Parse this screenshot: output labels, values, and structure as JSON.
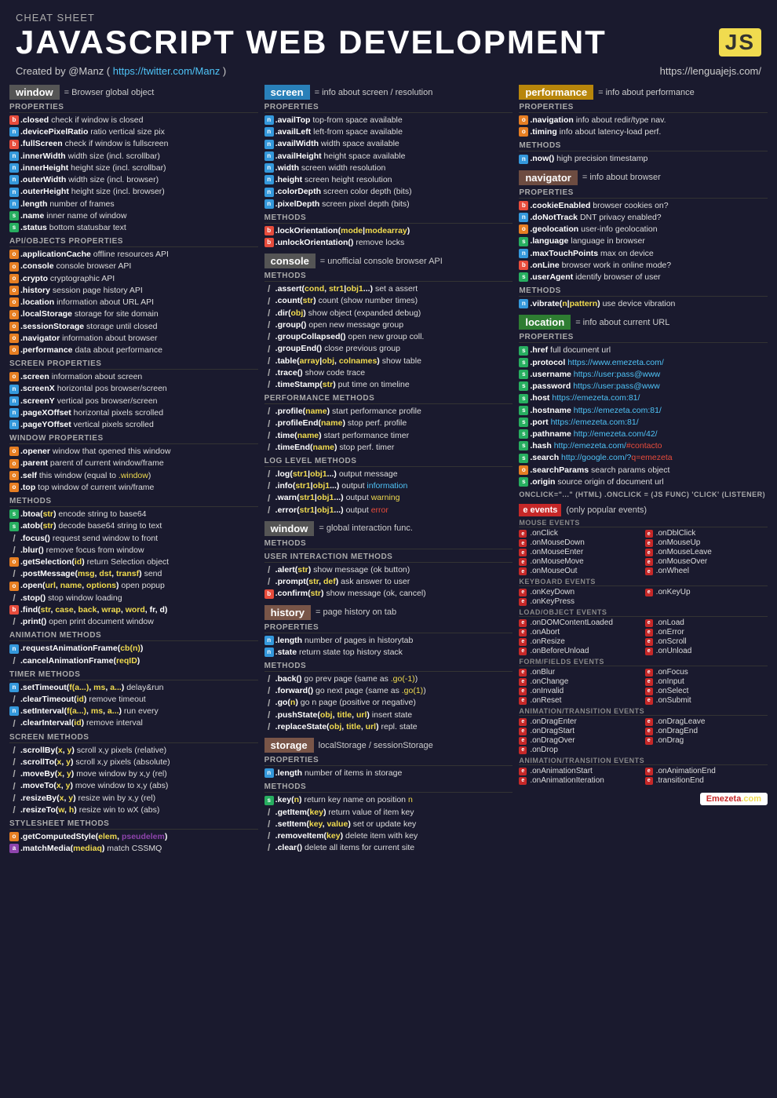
{
  "header": {
    "cheat_label": "CHEAT SHEET",
    "title": "JAVASCRIPT  WEB DEVELOPMENT",
    "js_badge": "JS",
    "credit": "Created by @Manz ( https://twitter.com/Manz )",
    "site": "https://lenguajejs.com/"
  },
  "window": {
    "title": "window",
    "desc": "= Browser global object",
    "props_label": "PROPERTIES",
    "props": [
      {
        "badge": "b",
        "name": ".closed",
        "desc": "check if window is closed"
      },
      {
        "badge": "n",
        "name": ".devicePixelRatio",
        "desc": "ratio vertical size pix"
      },
      {
        "badge": "b",
        "name": ".fullScreen",
        "desc": "check if window is fullscreen"
      },
      {
        "badge": "n",
        "name": ".innerWidth",
        "desc": "width size (incl. scrollbar)"
      },
      {
        "badge": "n",
        "name": ".innerHeight",
        "desc": "height size (incl. scrollbar)"
      },
      {
        "badge": "n",
        "name": ".outerWidth",
        "desc": "width size (incl. browser)"
      },
      {
        "badge": "n",
        "name": ".outerHeight",
        "desc": "height size (incl. browser)"
      },
      {
        "badge": "n",
        "name": ".length",
        "desc": "number of frames"
      },
      {
        "badge": "s",
        "name": ".name",
        "desc": "inner name of window"
      },
      {
        "badge": "s",
        "name": ".status",
        "desc": "bottom statusbar text"
      }
    ],
    "api_label": "API/OBJECTS PROPERTIES",
    "api_props": [
      {
        "badge": "o",
        "name": ".applicationCache",
        "desc": "offline resources API"
      },
      {
        "badge": "o",
        "name": ".console",
        "desc": "console browser API"
      },
      {
        "badge": "o",
        "name": ".crypto",
        "desc": "cryptographic API"
      },
      {
        "badge": "o",
        "name": ".history",
        "desc": "session page history API"
      },
      {
        "badge": "o",
        "name": ".location",
        "desc": "information about URL API"
      },
      {
        "badge": "o",
        "name": ".localStorage",
        "desc": "storage for site domain"
      },
      {
        "badge": "o",
        "name": ".sessionStorage",
        "desc": "storage until closed"
      },
      {
        "badge": "o",
        "name": ".navigator",
        "desc": "information about browser"
      },
      {
        "badge": "o",
        "name": ".performance",
        "desc": "data about performance"
      }
    ],
    "screen_label": "SCREEN PROPERTIES",
    "screen_props": [
      {
        "badge": "o",
        "name": ".screen",
        "desc": "information about screen"
      },
      {
        "badge": "n",
        "name": ".screenX",
        "desc": "horizontal pos browser/screen"
      },
      {
        "badge": "n",
        "name": ".screenY",
        "desc": "vertical pos browser/screen"
      },
      {
        "badge": "n",
        "name": ".pageXOffset",
        "desc": "horizontal pixels scrolled"
      },
      {
        "badge": "n",
        "name": ".pageYOffset",
        "desc": "vertical pixels scrolled"
      }
    ],
    "window_label": "WINDOW PROPERTIES",
    "window_props": [
      {
        "badge": "o",
        "name": ".opener",
        "desc": "window that opened this window"
      },
      {
        "badge": "o",
        "name": ".parent",
        "desc": "parent of current window/frame"
      },
      {
        "badge": "o",
        "name": ".self",
        "desc": "this window (equal to .window)"
      },
      {
        "badge": "o",
        "name": ".top",
        "desc": "top window of current win/frame"
      }
    ],
    "methods_label": "METHODS",
    "methods": [
      {
        "badge": "s",
        "name": ".btoa(str)",
        "desc": "encode string to base64"
      },
      {
        "badge": "s",
        "name": ".atob(str)",
        "desc": "decode base64 string to text"
      },
      {
        "badge": "/",
        "name": ".focus()",
        "desc": "request send window to front"
      },
      {
        "badge": "/",
        "name": ".blur()",
        "desc": "remove focus from window"
      },
      {
        "badge": "o",
        "name": ".getSelection(id)",
        "desc": "return Selection object"
      },
      {
        "badge": "/",
        "name": ".postMessage(msg, dst, transf)",
        "desc": "send"
      },
      {
        "badge": "o",
        "name": ".open(url, name, options)",
        "desc": "open popup"
      },
      {
        "badge": "/",
        "name": ".stop()",
        "desc": "stop window loading"
      },
      {
        "badge": "b",
        "name": ".find(str, case, back, wrap, word, fr, d)"
      },
      {
        "badge": "/",
        "name": ".print()",
        "desc": "open print document window"
      }
    ],
    "anim_label": "ANIMATION METHODS",
    "anim_methods": [
      {
        "badge": "n",
        "name": ".requestAnimationFrame(cb(n))"
      },
      {
        "badge": "/",
        "name": ".cancelAnimationFrame(reqID)"
      }
    ],
    "timer_label": "TIMER METHODS",
    "timer_methods": [
      {
        "badge": "n",
        "name": ".setTimeout(f(a...), ms, a...)",
        "desc": "delay&run"
      },
      {
        "badge": "/",
        "name": ".clearTimeout(id)",
        "desc": "remove timeout"
      },
      {
        "badge": "n",
        "name": ".setInterval(f(a...), ms, a...)",
        "desc": "run every"
      },
      {
        "badge": "/",
        "name": ".clearInterval(id)",
        "desc": "remove interval"
      }
    ],
    "screen_meth_label": "SCREEN METHODS",
    "screen_methods": [
      {
        "badge": "/",
        "name": ".scrollBy(x, y)",
        "desc": "scroll x,y pixels (relative)"
      },
      {
        "badge": "/",
        "name": ".scrollTo(x, y)",
        "desc": "scroll x,y pixels (absolute)"
      },
      {
        "badge": "/",
        "name": ".moveBy(x, y)",
        "desc": "move window by x,y (rel)"
      },
      {
        "badge": "/",
        "name": ".moveTo(x, y)",
        "desc": "move window to x,y (abs)"
      },
      {
        "badge": "/",
        "name": ".resizeBy(x, y)",
        "desc": "resize win by x,y (rel)"
      },
      {
        "badge": "/",
        "name": ".resizeTo(w, h)",
        "desc": "resize win to wX (abs)"
      }
    ],
    "stylesheet_label": "STYLESHEET METHODS",
    "stylesheet_methods": [
      {
        "badge": "o",
        "name": ".getComputedStyle(elem, pseudelem)"
      },
      {
        "badge": "a",
        "name": ".matchMedia(mediaq)",
        "desc": "match CSSMQ"
      }
    ]
  }
}
